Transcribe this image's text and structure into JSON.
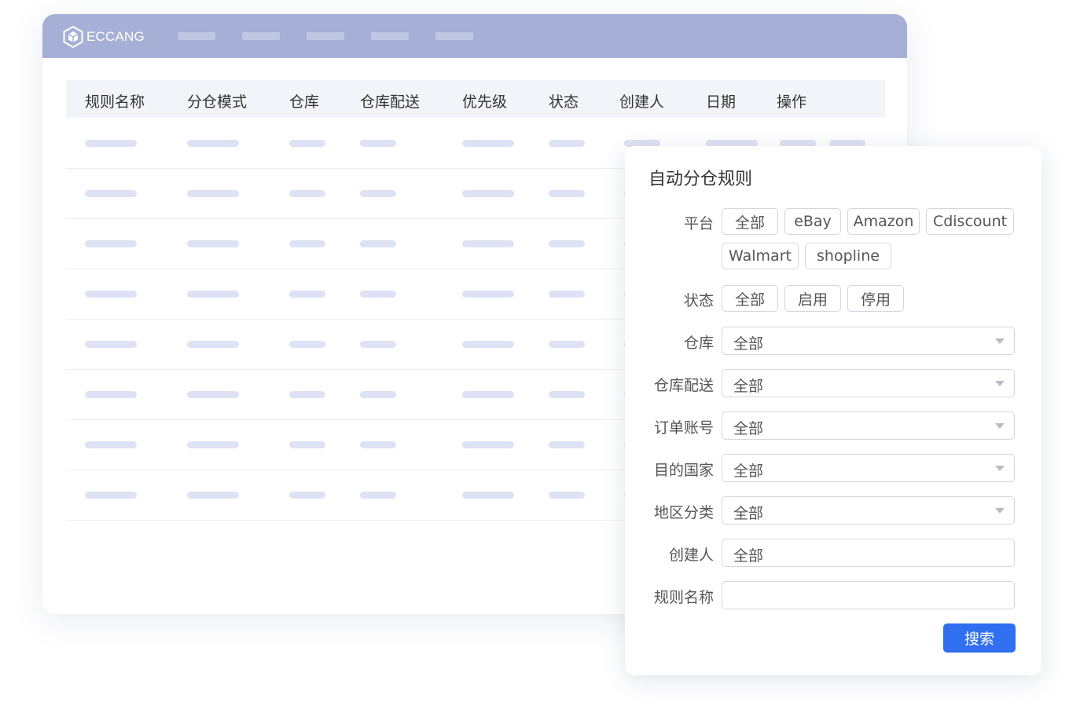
{
  "app": {
    "logo_text": "ECCANG"
  },
  "table": {
    "headers": [
      "规则名称",
      "分仓模式",
      "仓库",
      "仓库配送",
      "优先级",
      "状态",
      "创建人",
      "日期",
      "操作"
    ]
  },
  "filter_panel": {
    "title": "自动分仓规则",
    "platform": {
      "label": "平台",
      "options": [
        "全部",
        "eBay",
        "Amazon",
        "Cdiscount",
        "Walmart",
        "shopline"
      ]
    },
    "status": {
      "label": "状态",
      "options": [
        "全部",
        "启用",
        "停用"
      ]
    },
    "warehouse": {
      "label": "仓库",
      "value": "全部"
    },
    "warehouse_delivery": {
      "label": "仓库配送",
      "value": "全部"
    },
    "order_account": {
      "label": "订单账号",
      "value": "全部"
    },
    "destination_country": {
      "label": "目的国家",
      "value": "全部"
    },
    "region_category": {
      "label": "地区分类",
      "value": "全部"
    },
    "creator": {
      "label": "创建人",
      "value": "全部"
    },
    "rule_name": {
      "label": "规则名称",
      "value": ""
    },
    "search_label": "搜索"
  },
  "colors": {
    "topbar": "#a6b0d6",
    "primary": "#2f6ff0",
    "placeholder": "#dde2f4"
  }
}
